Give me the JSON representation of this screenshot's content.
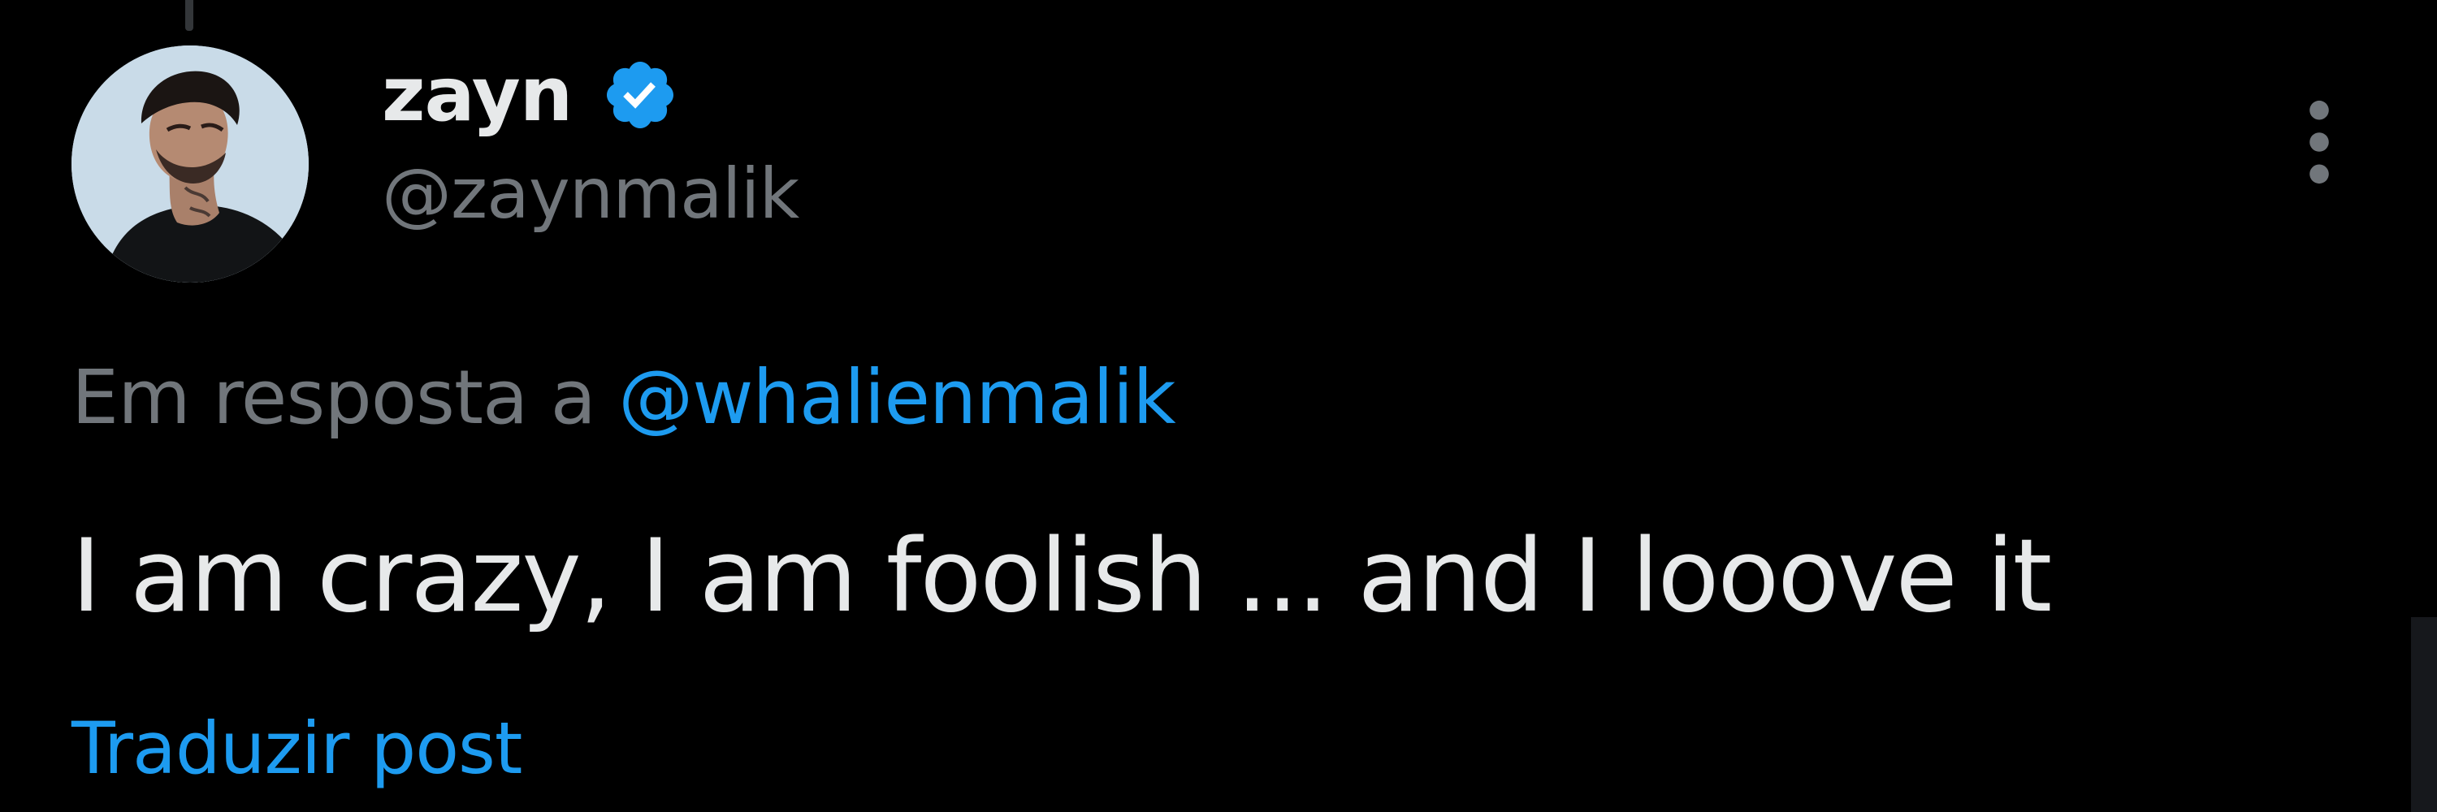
{
  "tweet": {
    "display_name": "zayn",
    "handle": "@zaynmalik",
    "verified": true,
    "reply_prefix": "Em resposta a",
    "reply_to": "@whalienmalik",
    "text": "I am crazy, I am foolish ... and I looove it",
    "translate_label": "Traduzir post"
  },
  "icons": {
    "avatar": "profile-photo",
    "verified": "verified-badge-icon",
    "more": "more-vertical-icon"
  },
  "colors": {
    "background": "#000000",
    "primary_text": "#e7e9ea",
    "secondary_text": "#71767b",
    "link": "#1d9bf0",
    "verified": "#1d9bf0"
  }
}
